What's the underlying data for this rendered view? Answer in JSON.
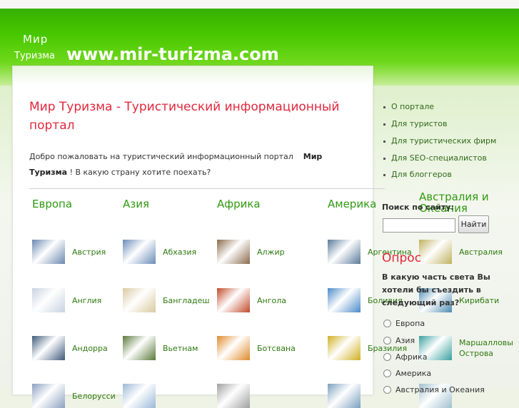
{
  "header": {
    "logo_top": "Мир",
    "logo_bottom": "Туризма",
    "site_url": "www.mir-turizma.com"
  },
  "main": {
    "title": "Мир Туризма - Туристический информационный портал",
    "welcome_before": "Добро пожаловать на туристический информационный портал",
    "welcome_brand": "Мир Туризма",
    "welcome_after": "! В какую страну хотите поехать?"
  },
  "regions": [
    {
      "name": "Европа",
      "countries": [
        "Австрия",
        "Англия",
        "Андорра",
        "Белорусси"
      ]
    },
    {
      "name": "Азия",
      "countries": [
        "Абхазия",
        "Бангладеш",
        "Вьетнам",
        ""
      ]
    },
    {
      "name": "Африка",
      "countries": [
        "Алжир",
        "Ангола",
        "Ботсвана",
        ""
      ]
    },
    {
      "name": "Америка",
      "countries": [
        "Аргентина",
        "Боливия",
        "Бразилия",
        ""
      ]
    },
    {
      "name": "Австралия и Океания",
      "countries": [
        "Австралия",
        "Кирибати",
        "Маршалловы Острова",
        ""
      ]
    }
  ],
  "sidebar": {
    "links": [
      "О портале",
      "Для туристов",
      "Для туристических фирм",
      "Для SEO-специалистов",
      "Для блоггеров"
    ],
    "search_label": "Поиск по сайту:",
    "search_value": "",
    "search_button": "Найти"
  },
  "poll": {
    "title": "Опрос",
    "question": "В какую часть света Вы хотели бы съездить в следующий раз?",
    "options": [
      "Европа",
      "Азия",
      "Африка",
      "Америка",
      "Австралия и Океания"
    ]
  },
  "colors": {
    "accent_red": "#e0283c",
    "link_green": "#2f7a10",
    "header_green": "#49c800"
  }
}
